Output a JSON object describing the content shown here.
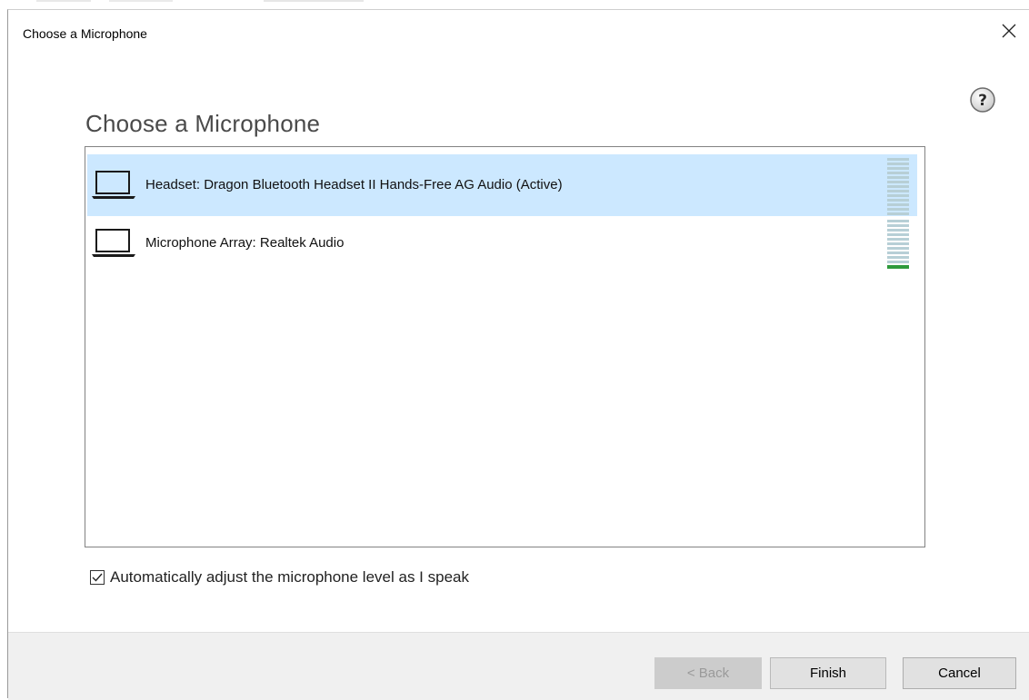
{
  "window": {
    "title": "Choose a Microphone",
    "close_icon": "close-icon",
    "help_icon": "help-icon"
  },
  "heading": "Choose a Microphone",
  "devices": [
    {
      "label": "Headset: Dragon Bluetooth Headset II Hands-Free AG Audio (Active)",
      "icon": "laptop-icon",
      "selected": true,
      "level": 0
    },
    {
      "label": "Microphone Array: Realtek Audio",
      "icon": "laptop-icon",
      "selected": false,
      "level": 0.1
    }
  ],
  "auto_adjust": {
    "label": "Automatically adjust the microphone level as I speak",
    "checked": true
  },
  "buttons": {
    "back": "< Back",
    "finish": "Finish",
    "cancel": "Cancel"
  },
  "colors": {
    "selection": "#cce8ff",
    "meter_off": "#b7cfd6",
    "meter_on": "#2e9a3c"
  }
}
